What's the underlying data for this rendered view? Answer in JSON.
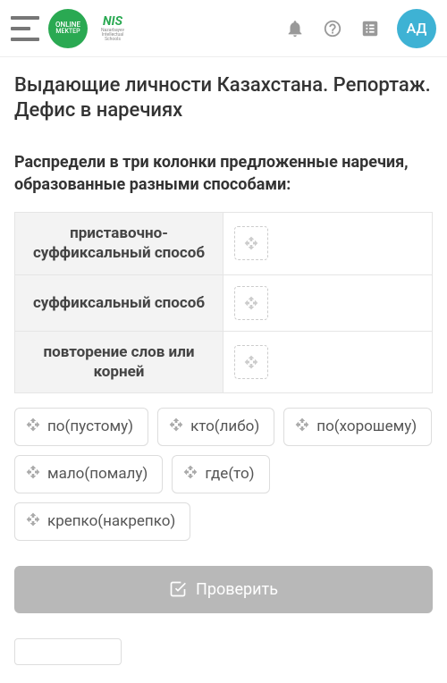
{
  "header": {
    "logo_om_line1": "ONLINE",
    "logo_om_line2": "MEKTEP",
    "logo_nis": "NIS",
    "logo_nis_sub": "Nazarbayev Intellectual Schools",
    "avatar_initials": "АД"
  },
  "page": {
    "title": "Выдающие личности Казахстана. Репортаж. Дефис в наречиях",
    "instruction": "Распредели в три колонки предложенные наречия, образованные разными способами:"
  },
  "table": {
    "rows": [
      {
        "label": "приставочно-суффиксальный способ"
      },
      {
        "label": "суффиксальный способ"
      },
      {
        "label": "повторение слов или корней"
      }
    ]
  },
  "chips": [
    "по(пустому)",
    "кто(либо)",
    "по(хорошему)",
    "мало(помалу)",
    "где(то)",
    "крепко(накрепко)"
  ],
  "buttons": {
    "check": "Проверить"
  }
}
